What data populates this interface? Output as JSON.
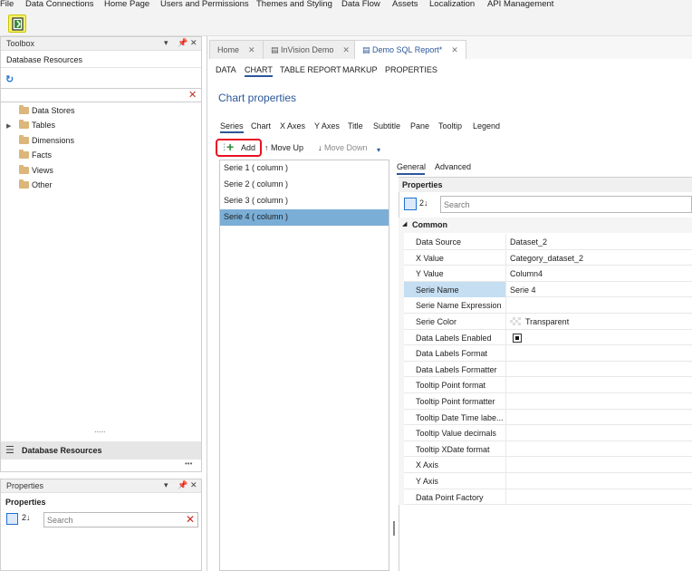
{
  "menu": [
    "File",
    "Data Connections",
    "Home Page",
    "Users and Permissions",
    "Themes and Styling",
    "Data Flow",
    "Assets",
    "Localization",
    "API Management"
  ],
  "toolbox": {
    "title": "Toolbox",
    "section": "Database Resources",
    "search_value": "",
    "items": [
      "Data Stores",
      "Tables",
      "Dimensions",
      "Facts",
      "Views",
      "Other"
    ],
    "dots": ".....",
    "footer_label": "Database Resources",
    "more": "•••"
  },
  "properties_panel": {
    "title": "Properties",
    "heading": "Properties",
    "search_placeholder": "Search"
  },
  "doc_tabs": [
    {
      "label": "Home",
      "close": "✕"
    },
    {
      "label": "InVision Demo",
      "close": "✕"
    },
    {
      "label": "Demo SQL Report*",
      "close": "✕"
    }
  ],
  "sub_tabs": [
    "DATA",
    "CHART",
    "TABLE REPORT",
    "MARKUP",
    "PROPERTIES"
  ],
  "chart_properties": {
    "title": "Chart properties",
    "tabs": [
      "Series",
      "Chart",
      "X Axes",
      "Y Axes",
      "Title",
      "Subtitle",
      "Pane",
      "Tooltip",
      "Legend"
    ]
  },
  "series_toolbar": {
    "add": "Add",
    "move_up": "Move Up",
    "move_down": "Move Down"
  },
  "series": [
    "Serie 1  ( column )",
    "Serie 2  ( column )",
    "Serie 3  ( column )",
    "Serie 4  ( column )"
  ],
  "detail_tabs": [
    "General",
    "Advanced"
  ],
  "grid": {
    "heading": "Properties",
    "search_placeholder": "Search",
    "category": "Common",
    "rows": [
      {
        "name": "Data Source",
        "value": "Dataset_2"
      },
      {
        "name": "X Value",
        "value": "Category_dataset_2"
      },
      {
        "name": "Y Value",
        "value": "Column4"
      },
      {
        "name": "Serie Name",
        "value": "Serie 4"
      },
      {
        "name": "Serie Name Expression",
        "value": ""
      },
      {
        "name": "Serie Color",
        "value": "Transparent"
      },
      {
        "name": "Data Labels Enabled",
        "value": ""
      },
      {
        "name": "Data Labels Format",
        "value": ""
      },
      {
        "name": "Data Labels Formatter",
        "value": ""
      },
      {
        "name": "Tooltip Point format",
        "value": ""
      },
      {
        "name": "Tooltip Point formatter",
        "value": ""
      },
      {
        "name": "Tooltip Date Time labe...",
        "value": ""
      },
      {
        "name": "Tooltip Value decimals",
        "value": ""
      },
      {
        "name": "Tooltip XDate format",
        "value": ""
      },
      {
        "name": "X Axis",
        "value": ""
      },
      {
        "name": "Y Axis",
        "value": ""
      },
      {
        "name": "Data Point Factory",
        "value": ""
      }
    ]
  },
  "colors": {
    "accent": "#2b579a",
    "selection": "#7aaed6",
    "highlight": "#e81123",
    "add_green": "#2e8b3a"
  }
}
